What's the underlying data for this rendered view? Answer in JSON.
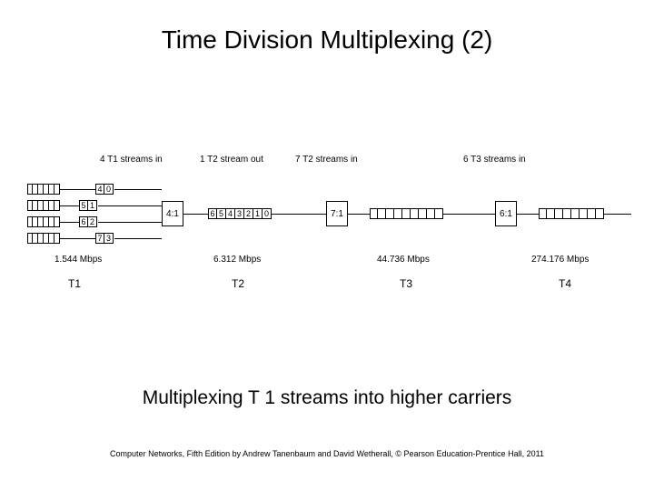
{
  "title": "Time Division Multiplexing (2)",
  "subtitle": "Multiplexing T 1 streams into higher carriers",
  "footer": "Computer Networks, Fifth Edition by Andrew Tanenbaum and David Wetherall, © Pearson Education-Prentice Hall, 2011",
  "labels": {
    "t1_in": "4 T1 streams in",
    "t2_in": "7 T2 streams in",
    "t3_in": "6 T3 streams in",
    "t2_out": "1 T2 stream out"
  },
  "mux": {
    "a": "4:1",
    "b": "7:1",
    "c": "6:1"
  },
  "t1_pairs": [
    {
      "a": "4",
      "b": "0"
    },
    {
      "a": "5",
      "b": "1"
    },
    {
      "a": "6",
      "b": "2"
    },
    {
      "a": "7",
      "b": "3"
    }
  ],
  "t2_cells": [
    "6",
    "5",
    "4",
    "3",
    "2",
    "1",
    "0"
  ],
  "rates": {
    "t1": "1.544 Mbps",
    "t2": "6.312 Mbps",
    "t3": "44.736 Mbps",
    "t4": "274.176 Mbps"
  },
  "tiers": {
    "t1": "T1",
    "t2": "T2",
    "t3": "T3",
    "t4": "T4"
  }
}
